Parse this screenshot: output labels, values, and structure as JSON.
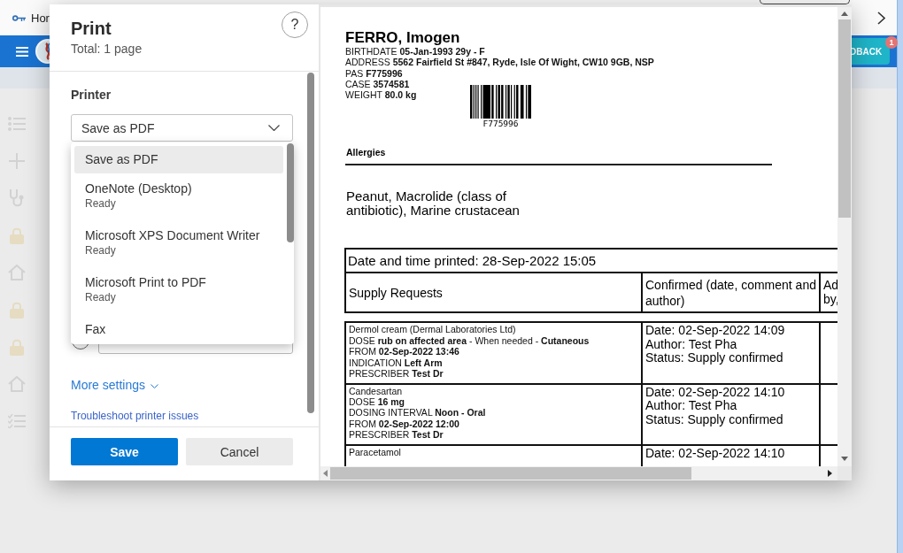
{
  "browser_bar": {
    "bookmark": "Hor"
  },
  "app_header": {
    "feedback_button": {
      "label": "DBACK",
      "badge": "1"
    }
  },
  "print_dialog": {
    "title": "Print",
    "summary": "Total: 1 page",
    "help_button": "?",
    "printer": {
      "label": "Printer",
      "value": "Save as PDF",
      "expanded": true,
      "options": [
        {
          "name": "Save as PDF",
          "selected": true
        },
        {
          "name": "OneNote (Desktop)",
          "status": "Ready",
          "selected": false
        },
        {
          "name": "Microsoft XPS Document Writer",
          "status": "Ready",
          "selected": false
        },
        {
          "name": "Microsoft Print to PDF",
          "status": "Ready",
          "selected": false
        },
        {
          "name": "Fax",
          "selected": false
        }
      ]
    },
    "page_range": {
      "selected": false
    },
    "more_settings": "More settings",
    "troubleshoot_link": "Troubleshoot printer issues",
    "buttons": [
      {
        "label": "Save",
        "kind": "primary"
      },
      {
        "label": "Cancel",
        "kind": "secondary"
      }
    ]
  },
  "preview": {
    "patient_name": "FERRO, Imogen",
    "details": [
      "BIRTHDATE **05-Jan-1993 29y - F**",
      "ADDRESS **5562 Fairfield St #847, Ryde, Isle Of Wight, CW10 9GB, NSP**",
      "PAS **F775996**",
      "CASE **3574581**",
      "WEIGHT **80.0 kg**"
    ],
    "barcode_text": "F775996",
    "allergies_heading": "Allergies",
    "allergies": "Peanut, Macrolide (class of antibiotic), Marine crustacean",
    "printed_at": "Date and time printed: 28-Sep-2022 15:05",
    "columns": [
      "Supply Requests",
      "Confirmed (date, comment and author)",
      "Ad by,"
    ],
    "rows": [
      {
        "request": [
          "Dermol cream (Dermal Laboratories Ltd)",
          "DOSE **rub on affected area** - When needed - **Cutaneous**",
          "FROM **02-Sep-2022 13:46**",
          "INDICATION **Left Arm**",
          "PRESCRIBER **Test Dr**"
        ],
        "confirmation": [
          "Date: 02-Sep-2022 14:09",
          "Author: Test Pha",
          "Status: Supply confirmed"
        ]
      },
      {
        "request": [
          "Candesartan",
          "DOSE **16 mg**",
          "DOSING INTERVAL **Noon - Oral**",
          "FROM **02-Sep-2022 12:00**",
          "PRESCRIBER **Test Dr**"
        ],
        "confirmation": [
          "Date: 02-Sep-2022 14:10",
          "Author: Test Pha",
          "Status: Supply confirmed"
        ]
      },
      {
        "request": [
          "Paracetamol"
        ],
        "confirmation": [
          "Date: 02-Sep-2022 14:10"
        ]
      }
    ]
  }
}
